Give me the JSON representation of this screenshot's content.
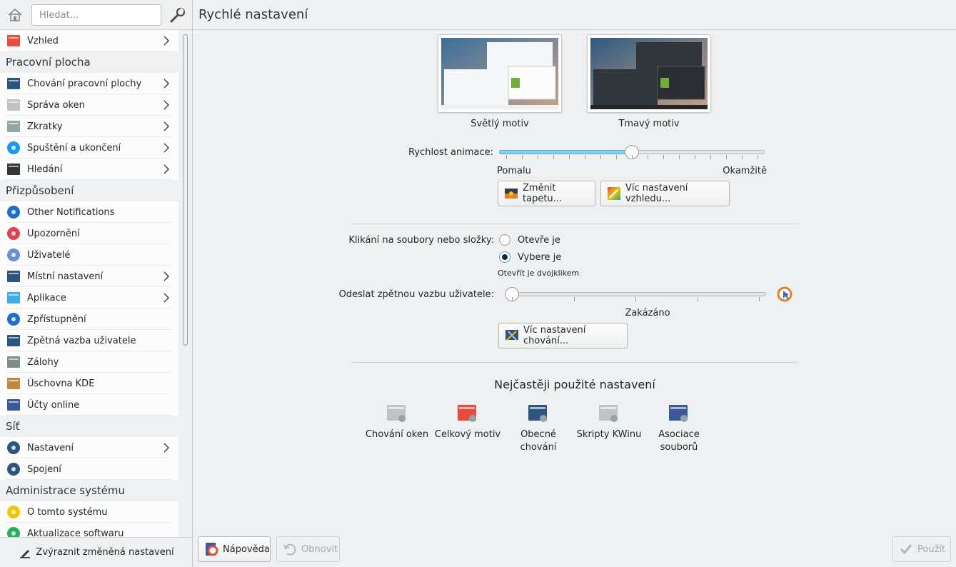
{
  "sidebar": {
    "search_placeholder": "Hledat...",
    "items": [
      {
        "type": "item",
        "label": "Vzhled",
        "icon": "appearance-icon",
        "chevron": true
      },
      {
        "type": "category",
        "label": "Pracovní plocha"
      },
      {
        "type": "item",
        "label": "Chování pracovní plochy",
        "icon": "desktop-behavior-icon",
        "chevron": true
      },
      {
        "type": "item",
        "label": "Správa oken",
        "icon": "window-management-icon",
        "chevron": true
      },
      {
        "type": "item",
        "label": "Zkratky",
        "icon": "shortcuts-icon",
        "chevron": true
      },
      {
        "type": "item",
        "label": "Spuštění a ukončení",
        "icon": "startup-shutdown-icon",
        "chevron": true
      },
      {
        "type": "item",
        "label": "Hledání",
        "icon": "search-binoculars-icon",
        "chevron": true
      },
      {
        "type": "category",
        "label": "Přizpůsobení"
      },
      {
        "type": "item",
        "label": "Other Notifications",
        "icon": "notification-icon",
        "chevron": false
      },
      {
        "type": "item",
        "label": "Upozornění",
        "icon": "bell-icon",
        "chevron": false
      },
      {
        "type": "item",
        "label": "Uživatelé",
        "icon": "user-icon",
        "chevron": false
      },
      {
        "type": "item",
        "label": "Místní nastavení",
        "icon": "locale-icon",
        "chevron": true
      },
      {
        "type": "item",
        "label": "Aplikace",
        "icon": "applications-icon",
        "chevron": true
      },
      {
        "type": "item",
        "label": "Zpřístupnění",
        "icon": "accessibility-icon",
        "chevron": false
      },
      {
        "type": "item",
        "label": "Zpětná vazba uživatele",
        "icon": "feedback-icon",
        "chevron": false
      },
      {
        "type": "item",
        "label": "Zálohy",
        "icon": "backup-icon",
        "chevron": false
      },
      {
        "type": "item",
        "label": "Úschovna KDE",
        "icon": "wallet-icon",
        "chevron": false
      },
      {
        "type": "item",
        "label": "Účty online",
        "icon": "online-accounts-icon",
        "chevron": false
      },
      {
        "type": "category",
        "label": "Síť"
      },
      {
        "type": "item",
        "label": "Nastavení",
        "icon": "network-settings-icon",
        "chevron": true
      },
      {
        "type": "item",
        "label": "Spojení",
        "icon": "connections-icon",
        "chevron": false
      },
      {
        "type": "category",
        "label": "Administrace systému"
      },
      {
        "type": "item",
        "label": "O tomto systému",
        "icon": "about-system-icon",
        "chevron": false
      },
      {
        "type": "item",
        "label": "Aktualizace softwaru",
        "icon": "software-update-icon",
        "chevron": false
      }
    ],
    "highlight_changed": "Zvýraznit změněná nastavení"
  },
  "main": {
    "title": "Rychlé nastavení",
    "themes": [
      {
        "label": "Světlý motiv",
        "variant": "light"
      },
      {
        "label": "Tmavý motiv",
        "variant": "dark"
      }
    ],
    "animation": {
      "label": "Rychlost animace:",
      "min_label": "Pomalu",
      "max_label": "Okamžitě",
      "value_fraction": 0.5,
      "tick_count": 17
    },
    "change_wallpaper": "Změnit tapetu...",
    "more_appearance": "Víc nastavení vzhledu...",
    "click_behavior": {
      "label": "Klikání na soubory nebo složky:",
      "options": [
        {
          "label": "Otevře je",
          "selected": false
        },
        {
          "label": "Vybere je",
          "selected": true
        }
      ],
      "hint": "Otevřít je dvojklikem"
    },
    "feedback": {
      "label": "Odeslat zpětnou vazbu uživatele:",
      "value_label": "Zakázáno",
      "value_step": 0,
      "steps": 4
    },
    "more_behavior": "Víc nastavení chování...",
    "frequent_title": "Nejčastěji použité nastavení",
    "frequent": [
      {
        "label": "Chování oken",
        "icon": "window-behavior-icon"
      },
      {
        "label": "Celkový motiv",
        "icon": "global-theme-icon"
      },
      {
        "label": "Obecné chování",
        "icon": "general-behavior-icon"
      },
      {
        "label": "Skripty KWinu",
        "icon": "kwin-scripts-icon"
      },
      {
        "label": "Asociace souborů",
        "icon": "file-associations-icon"
      }
    ]
  },
  "footer": {
    "help": "Nápověda",
    "reset": "Obnovit",
    "apply": "Použít"
  },
  "colors": {
    "accent": "#3daee9",
    "background": "#eff0f1",
    "list_bg": "#fcfcfc"
  }
}
